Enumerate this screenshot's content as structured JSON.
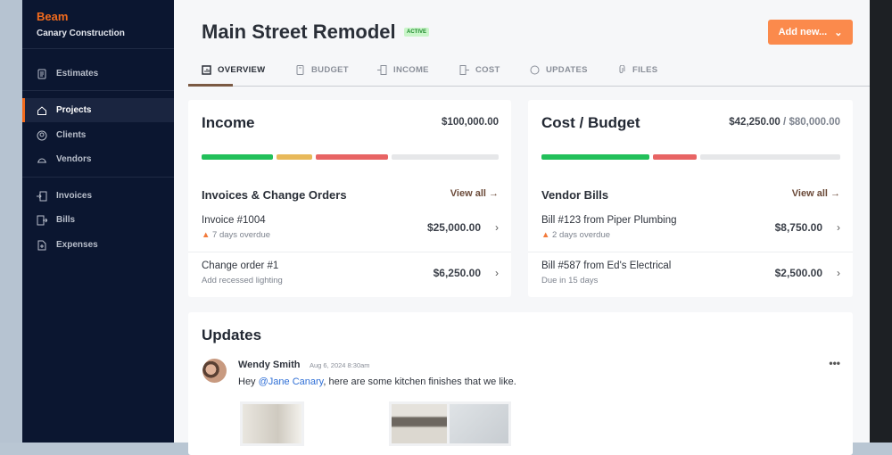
{
  "sidebar": {
    "logo": "Beam",
    "company": "Canary Construction",
    "items": [
      {
        "label": "Estimates",
        "icon": "document-icon"
      },
      {
        "label": "Projects",
        "icon": "home-icon",
        "active": true
      },
      {
        "label": "Clients",
        "icon": "user-circle-icon"
      },
      {
        "label": "Vendors",
        "icon": "hardhat-icon"
      },
      {
        "label": "Invoices",
        "icon": "invoice-in-icon"
      },
      {
        "label": "Bills",
        "icon": "bill-out-icon"
      },
      {
        "label": "Expenses",
        "icon": "expense-icon"
      }
    ]
  },
  "header": {
    "title": "Main Street Remodel",
    "status": "ACTIVE",
    "add_new": "Add new..."
  },
  "tabs": [
    {
      "label": "OVERVIEW",
      "active": true
    },
    {
      "label": "BUDGET"
    },
    {
      "label": "INCOME"
    },
    {
      "label": "COST"
    },
    {
      "label": "UPDATES"
    },
    {
      "label": "FILES"
    }
  ],
  "income": {
    "title": "Income",
    "total": "$100,000.00",
    "bar": [
      {
        "fraction": 0.25,
        "color": "#22c05a"
      },
      {
        "fraction": 0.125,
        "color": "#e8b95a"
      },
      {
        "fraction": 0.25,
        "color": "#e86464"
      },
      {
        "fraction": 0.375,
        "color": "#e6e7e9"
      }
    ],
    "section": "Invoices & Change Orders",
    "view_all": "View all",
    "rows": [
      {
        "title": "Invoice #1004",
        "sub": "7 days overdue",
        "warn": true,
        "amount": "$25,000.00"
      },
      {
        "title": "Change order #1",
        "sub": "Add recessed lighting",
        "amount": "$6,250.00"
      }
    ]
  },
  "cost": {
    "title": "Cost / Budget",
    "spent": "$42,250.00",
    "separator": "/",
    "budget": "$80,000.00",
    "bar": [
      {
        "fraction": 0.37,
        "color": "#22c05a"
      },
      {
        "fraction": 0.15,
        "color": "#e86464"
      },
      {
        "fraction": 0.48,
        "color": "#e6e7e9"
      }
    ],
    "section": "Vendor Bills",
    "view_all": "View all",
    "rows": [
      {
        "title": "Bill #123 from Piper Plumbing",
        "sub": "2 days overdue",
        "warn": true,
        "amount": "$8,750.00"
      },
      {
        "title": "Bill #587 from Ed's Electrical",
        "sub": "Due in 15 days",
        "amount": "$2,500.00"
      }
    ]
  },
  "updates": {
    "title": "Updates",
    "author": "Wendy Smith",
    "date": "Aug 6, 2024 8:30am",
    "msg_pre": "Hey ",
    "mention": "@Jane Canary",
    "msg_post": ", here are some kitchen finishes that we like."
  }
}
